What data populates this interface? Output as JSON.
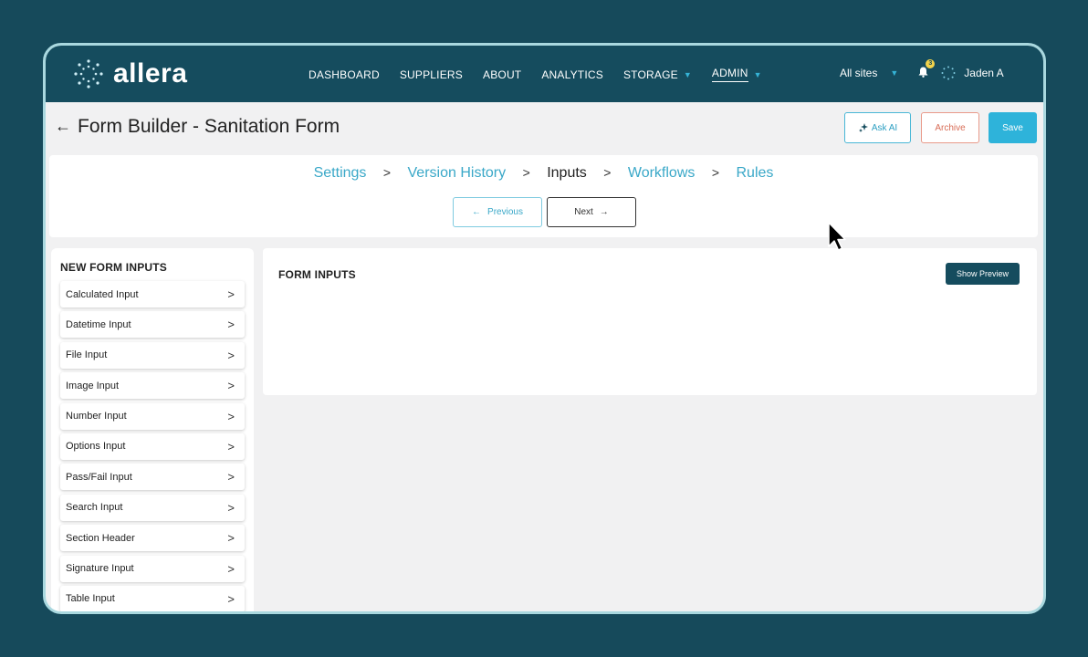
{
  "app": {
    "logo_text": "allera",
    "brand_dark": "#154c5e",
    "accent": "#2eb3da"
  },
  "nav": {
    "items": [
      {
        "label": "DASHBOARD",
        "has_dropdown": false
      },
      {
        "label": "SUPPLIERS",
        "has_dropdown": false
      },
      {
        "label": "ABOUT",
        "has_dropdown": false
      },
      {
        "label": "ANALYTICS",
        "has_dropdown": false
      },
      {
        "label": "STORAGE",
        "has_dropdown": true
      },
      {
        "label": "ADMIN",
        "has_dropdown": true,
        "active": true
      }
    ],
    "sites": "All sites",
    "notification_count": "3",
    "user": "Jaden A"
  },
  "page": {
    "title": "Form Builder - Sanitation Form",
    "ask_ai": "Ask AI",
    "archive": "Archive",
    "save": "Save"
  },
  "steps": {
    "items": [
      "Settings",
      "Version History",
      "Inputs",
      "Workflows",
      "Rules"
    ],
    "current": "Inputs",
    "previous": "Previous",
    "next": "Next"
  },
  "sidebar": {
    "title": "NEW FORM INPUTS",
    "items": [
      "Calculated Input",
      "Datetime Input",
      "File Input",
      "Image Input",
      "Number Input",
      "Options Input",
      "Pass/Fail Input",
      "Search Input",
      "Section Header",
      "Signature Input",
      "Table Input"
    ]
  },
  "main": {
    "title": "FORM INPUTS",
    "show_preview": "Show Preview"
  }
}
